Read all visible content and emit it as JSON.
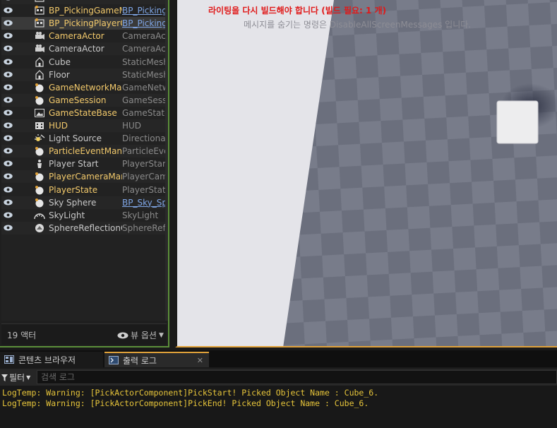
{
  "outliner": {
    "rows": [
      {
        "name": "",
        "type": "",
        "icon": "blueprint-icon",
        "name_color": "yellow",
        "type_link": false
      },
      {
        "name": "BP_PickingGameMo",
        "type": "BP_Picking",
        "icon": "blueprint-icon",
        "name_color": "yellow",
        "type_link": true
      },
      {
        "name": "BP_PickingPlayerC",
        "type": "BP_Picking",
        "icon": "blueprint-icon",
        "name_color": "yellow",
        "type_link": true,
        "selected": true
      },
      {
        "name": "CameraActor",
        "type": "CameraActo",
        "icon": "camera-icon",
        "name_color": "yellow",
        "type_link": false
      },
      {
        "name": "CameraActor",
        "type": "CameraActo",
        "icon": "camera-icon",
        "name_color": "white",
        "type_link": false
      },
      {
        "name": "Cube",
        "type": "StaticMeshA",
        "icon": "house-icon",
        "name_color": "white",
        "type_link": false
      },
      {
        "name": "Floor",
        "type": "StaticMeshA",
        "icon": "house-icon",
        "name_color": "white",
        "type_link": false
      },
      {
        "name": "GameNetworkMana",
        "type": "GameNetwo",
        "icon": "sphere-icon",
        "name_color": "yellow",
        "type_link": false
      },
      {
        "name": "GameSession",
        "type": "GameSessio",
        "icon": "sphere-icon",
        "name_color": "yellow",
        "type_link": false
      },
      {
        "name": "GameStateBase",
        "type": "GameStateB",
        "icon": "picture-icon",
        "name_color": "yellow",
        "type_link": false
      },
      {
        "name": "HUD",
        "type": "HUD",
        "icon": "hud-icon",
        "name_color": "yellow",
        "type_link": false
      },
      {
        "name": "Light Source",
        "type": "DirectionalL",
        "icon": "sun-icon",
        "name_color": "white",
        "type_link": false
      },
      {
        "name": "ParticleEventMana",
        "type": "ParticleEven",
        "icon": "sphere-icon",
        "name_color": "yellow",
        "type_link": false
      },
      {
        "name": "Player Start",
        "type": "PlayerStart",
        "icon": "player-start-icon",
        "name_color": "white",
        "type_link": false
      },
      {
        "name": "PlayerCameraMana",
        "type": "PlayerCame",
        "icon": "sphere-icon",
        "name_color": "yellow",
        "type_link": false
      },
      {
        "name": "PlayerState",
        "type": "PlayerState",
        "icon": "sphere-icon",
        "name_color": "yellow",
        "type_link": false
      },
      {
        "name": "Sky Sphere",
        "type": "BP_Sky_Sp",
        "icon": "sphere-icon",
        "name_color": "white",
        "type_link": true
      },
      {
        "name": "SkyLight",
        "type": "SkyLight",
        "icon": "skylight-icon",
        "name_color": "white",
        "type_link": false
      },
      {
        "name": "SphereReflectionCa",
        "type": "SphereRefle",
        "icon": "reflection-icon",
        "name_color": "white",
        "type_link": false
      }
    ],
    "actor_count": "19 액터",
    "view_options": "뷰 옵션"
  },
  "viewport": {
    "lighting_warning": "라이팅을 다시 빌드해야 합니다 (빌드 필요: 1 개)",
    "hide_messages_hint": "메시지를 숨기는 명령은 DisableAllScreenMessages 입니다."
  },
  "bottom_panel": {
    "tabs": [
      {
        "label": "콘텐츠 브라우저",
        "icon": "content-browser-icon"
      },
      {
        "label": "출력 로그",
        "icon": "output-log-icon"
      }
    ],
    "filter_label": "필터",
    "search_placeholder": "검색 로그",
    "log_lines": [
      "LogTemp: Warning: [PickActorComponent]PickStart! Picked Object Name : Cube_6.",
      "LogTemp: Warning: [PickActorComponent]PickEnd! Picked Object Name : Cube_6."
    ]
  },
  "colors": {
    "name_yellow": "#f2c96b",
    "name_white": "#c8c8c8",
    "link_blue": "#7fa6e6",
    "warning_red": "#e01919",
    "log_yellow": "#e6c43a",
    "accent_orange": "#e0a23a",
    "outline_green": "#5c8f3a"
  }
}
